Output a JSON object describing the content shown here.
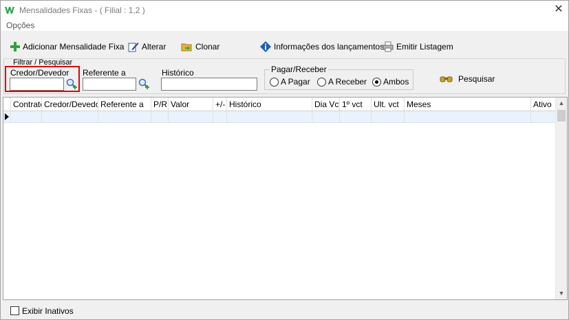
{
  "window": {
    "title": "Mensalidades Fixas - ( Filial : 1,2 )",
    "close_glyph": "✕"
  },
  "menu": {
    "items": [
      {
        "label": "Opções"
      }
    ]
  },
  "toolbar": {
    "add_label": "Adicionar Mensalidade Fixa",
    "edit_label": "Alterar",
    "clone_label": "Clonar",
    "info_label": "Informações dos lançamentos",
    "print_label": "Emitir Listagem"
  },
  "filter": {
    "legend": "Filtrar / Pesquisar",
    "credor_label": "Credor/Devedor",
    "credor_value": "",
    "referente_label": "Referente a",
    "referente_value": "",
    "historico_label": "Histórico",
    "historico_value": "",
    "pagar_receber": {
      "legend": "Pagar/Receber",
      "options": [
        "A Pagar",
        "A Receber",
        "Ambos"
      ],
      "selected": "Ambos"
    },
    "search_label": "Pesquisar"
  },
  "grid": {
    "columns": [
      "Contrato",
      "Credor/Devedor",
      "Referente a",
      "P/R",
      "Valor",
      "+/-",
      "Histórico",
      "Dia Vct",
      "1º vct",
      "Ult. vct",
      "Meses",
      "Ativo"
    ],
    "rows": [
      [
        "",
        "",
        "",
        "",
        "",
        "",
        "",
        "",
        "",
        "",
        "",
        ""
      ]
    ]
  },
  "footer": {
    "show_inactive_label": "Exibir Inativos",
    "show_inactive_checked": false
  },
  "colors": {
    "highlight": "#e00000",
    "row_selected": "#eaf3fb"
  }
}
